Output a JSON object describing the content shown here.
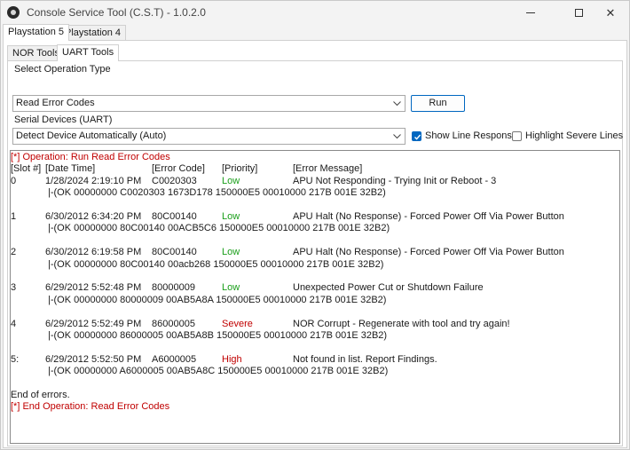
{
  "window": {
    "title": "Console Service Tool (C.S.T) - 1.0.2.0",
    "minimize_glyph": "",
    "close_glyph": "✕"
  },
  "outer_tabs": [
    "Playstation 5",
    "Playstation 4"
  ],
  "inner_tabs": [
    "NOR Tools",
    "UART Tools"
  ],
  "operation": {
    "label": "Select Operation Type",
    "value": "Read Error Codes",
    "run_label": "Run"
  },
  "serial": {
    "label": "Serial Devices (UART)",
    "value": "Detect Device Automatically (Auto)"
  },
  "options": {
    "show_line_response_label": "Show Line Response",
    "show_line_response_checked": true,
    "highlight_severe_label": "Highlight Severe Lines",
    "highlight_severe_checked": false
  },
  "log": {
    "start_line": "[*] Operation: Run Read Error Codes",
    "headers": [
      "[Slot #]",
      "[Date Time]",
      "[Error Code]",
      "[Priority]",
      "[Error Message]"
    ],
    "entries": [
      {
        "slot": "0",
        "datetime": "1/28/2024 2:19:10 PM",
        "code": "C0020303",
        "priority": "Low",
        "message": "APU Not Responding - Trying Init or Reboot - 3",
        "response": "|-(OK 00000000 C0020303 1673D178 150000E5 00010000 217B 001E 32B2)"
      },
      {
        "slot": "1",
        "datetime": "6/30/2012 6:34:20 PM",
        "code": "80C00140",
        "priority": "Low",
        "message": "APU Halt (No Response) - Forced Power Off Via Power Button",
        "response": "|-(OK 00000000 80C00140 00ACB5C6 150000E5 00010000 217B 001E 32B2)"
      },
      {
        "slot": "2",
        "datetime": "6/30/2012 6:19:58 PM",
        "code": "80C00140",
        "priority": "Low",
        "message": "APU Halt (No Response) - Forced Power Off Via Power Button",
        "response": "|-(OK 00000000 80C00140 00acb268 150000E5 00010000 217B 001E 32B2)"
      },
      {
        "slot": "3",
        "datetime": "6/29/2012 5:52:48 PM",
        "code": "80000009",
        "priority": "Low",
        "message": "Unexpected Power Cut or Shutdown Failure",
        "response": "|-(OK 00000000 80000009 00AB5A8A 150000E5 00010000 217B 001E 32B2)"
      },
      {
        "slot": "4",
        "datetime": "6/29/2012 5:52:49 PM",
        "code": "86000005",
        "priority": "Severe",
        "message": "NOR Corrupt - Regenerate with tool and try again!",
        "response": "|-(OK 00000000 86000005 00AB5A8B 150000E5 00010000 217B 001E 32B2)"
      },
      {
        "slot": "5:",
        "datetime": "6/29/2012 5:52:50 PM",
        "code": "A6000005",
        "priority": "High",
        "message": "Not found in list. Report Findings.",
        "response": "|-(OK 00000000 A6000005 00AB5A8C 150000E5 00010000 217B 001E 32B2)"
      }
    ],
    "end_errors": "End of errors.",
    "end_line": "[*] End Operation: Read Error Codes"
  },
  "colors": {
    "op_line": "#c00000",
    "low": "#1a9e1a",
    "severe": "#c00000",
    "high": "#c00000",
    "accent": "#0067c0"
  }
}
